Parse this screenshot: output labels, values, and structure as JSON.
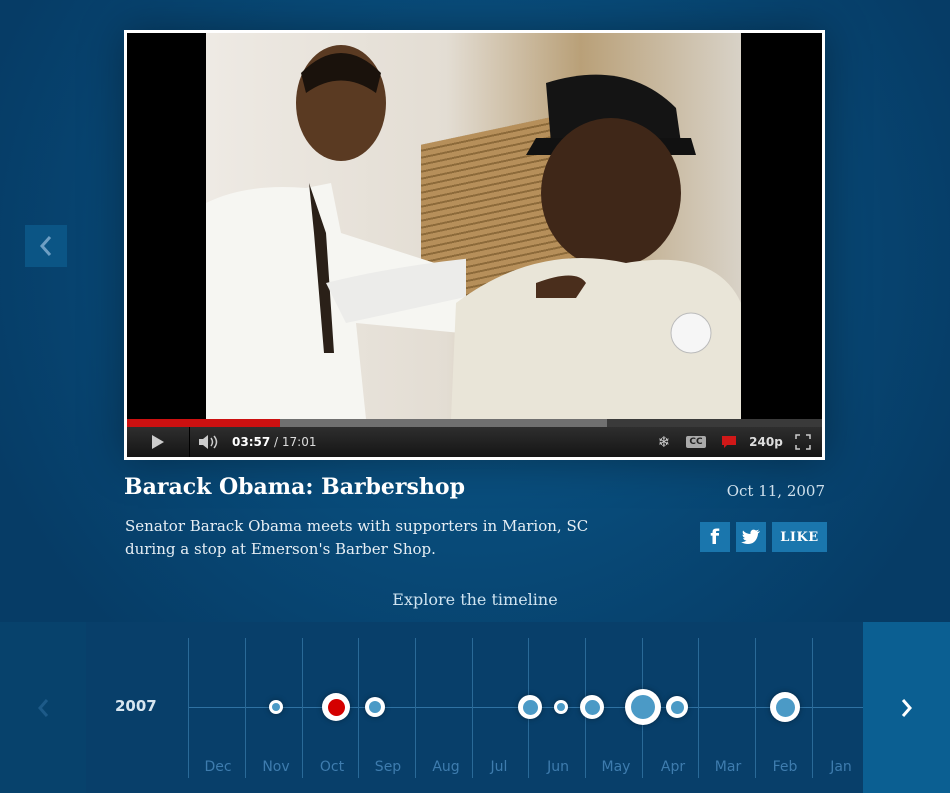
{
  "player": {
    "current_time": "03:57",
    "duration": "/ 17:01",
    "quality": "240p",
    "progress_played": 0.22,
    "progress_loaded": 0.69
  },
  "video": {
    "title": "Barack Obama: Barbershop",
    "date": "Oct 11, 2007",
    "description": "Senator Barack Obama meets with supporters in Marion, SC during a stop at Emerson's Barber Shop."
  },
  "share": {
    "like_label": "LIKE"
  },
  "explore_label": "Explore the timeline",
  "timeline": {
    "year": "2007",
    "months": [
      "Dec",
      "Nov",
      "Oct",
      "Sep",
      "Aug",
      "Jul",
      "Jun",
      "May",
      "Apr",
      "Mar",
      "Feb",
      "Jan"
    ]
  },
  "colors": {
    "background": "#084a78",
    "accent": "#1a76ad",
    "active_dot": "#d40000",
    "dot_fill": "#4b9ac6"
  }
}
